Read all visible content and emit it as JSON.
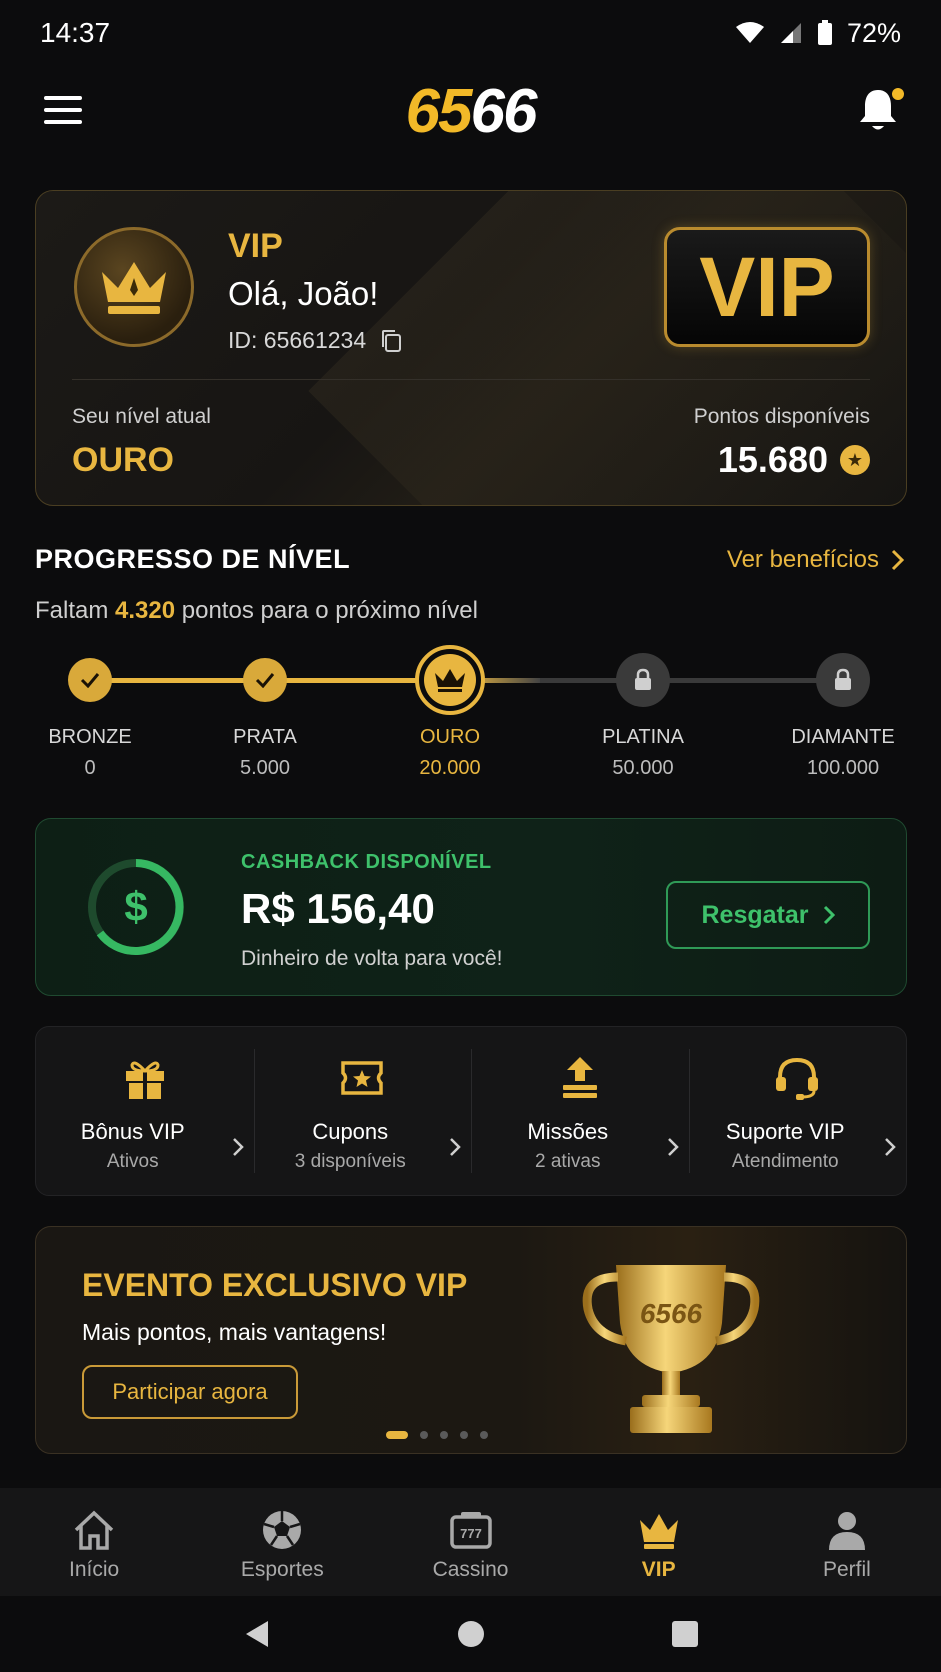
{
  "status": {
    "time": "14:37",
    "battery": "72%"
  },
  "header": {
    "logo_part1": "65",
    "logo_part2": "66"
  },
  "vip_card": {
    "badge_label": "VIP",
    "greeting": "Olá, João!",
    "user_id": "ID: 65661234",
    "logo_text": "VIP",
    "level_label": "Seu nível atual",
    "level_value": "OURO",
    "points_label": "Pontos disponíveis",
    "points_value": "15.680"
  },
  "progress": {
    "title": "PROGRESSO DE NÍVEL",
    "link": "Ver benefícios",
    "sub_prefix": "Faltam",
    "sub_points": "4.320",
    "sub_suffix": "pontos para o próximo nível",
    "steps": [
      {
        "name": "BRONZE",
        "points": "0",
        "state": "done"
      },
      {
        "name": "PRATA",
        "points": "5.000",
        "state": "done"
      },
      {
        "name": "OURO",
        "points": "20.000",
        "state": "current"
      },
      {
        "name": "PLATINA",
        "points": "50.000",
        "state": "locked"
      },
      {
        "name": "DIAMANTE",
        "points": "100.000",
        "state": "locked"
      }
    ]
  },
  "cashback": {
    "label": "CASHBACK DISPONÍVEL",
    "amount": "R$ 156,40",
    "subtitle": "Dinheiro de volta para você!",
    "button": "Resgatar"
  },
  "quick_actions": [
    {
      "title": "Bônus VIP",
      "subtitle": "Ativos",
      "icon": "gift-icon"
    },
    {
      "title": "Cupons",
      "subtitle": "3 disponíveis",
      "icon": "ticket-icon"
    },
    {
      "title": "Missões",
      "subtitle": "2 ativas",
      "icon": "upload-stack-icon"
    },
    {
      "title": "Suporte VIP",
      "subtitle": "Atendimento",
      "icon": "headset-icon"
    }
  ],
  "event": {
    "title": "EVENTO EXCLUSIVO VIP",
    "subtitle": "Mais pontos, mais vantagens!",
    "button": "Participar agora",
    "trophy_text": "6566"
  },
  "bottom_nav": [
    {
      "label": "Início",
      "icon": "home-icon"
    },
    {
      "label": "Esportes",
      "icon": "soccer-ball-icon"
    },
    {
      "label": "Cassino",
      "icon": "slot-machine-icon"
    },
    {
      "label": "VIP",
      "icon": "crown-icon",
      "active": true
    },
    {
      "label": "Perfil",
      "icon": "person-icon"
    }
  ],
  "colors": {
    "gold": "#e8b640",
    "green": "#3ec16b",
    "background": "#0c0c0d"
  }
}
